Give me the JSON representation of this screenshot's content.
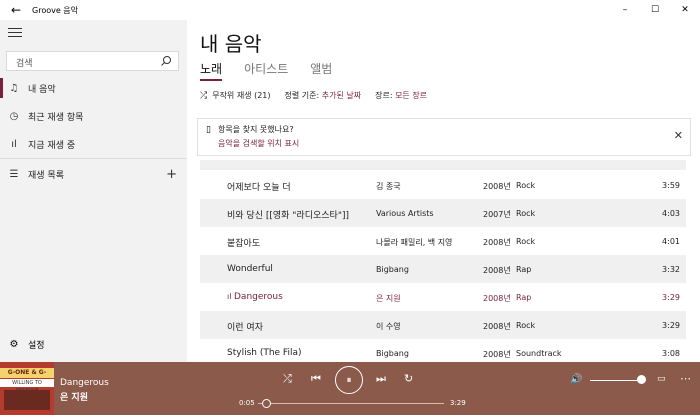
{
  "window": {
    "title": "Groove 음악",
    "back": "←",
    "min": "–",
    "max": "☐",
    "close": "✕"
  },
  "sidebar": {
    "search_placeholder": "검색",
    "items": [
      {
        "label": "내 음악",
        "icon": "music-note-icon",
        "glyph": "♫"
      },
      {
        "label": "최근 재생 항목",
        "icon": "clock-icon",
        "glyph": "◷"
      },
      {
        "label": "지금 재생 중",
        "icon": "equalizer-icon",
        "glyph": "ıl"
      },
      {
        "label": "재생 목록",
        "icon": "playlist-icon",
        "glyph": "☰"
      }
    ],
    "add": "+",
    "settings": {
      "label": "설정",
      "glyph": "⚙"
    }
  },
  "main": {
    "title": "내 음악",
    "tabs": [
      "노래",
      "아티스트",
      "앨범"
    ],
    "toolbar": {
      "shuffle_label": "무작위 재생 (21)",
      "sort_label": "정렬 기준:",
      "sort_value": "추가된 날짜",
      "genre_label": "장르:",
      "genre_value": "모든 장르"
    },
    "notice": {
      "question": "항목을 찾지 못했나요?",
      "link": "음악을 검색할 위치 표시",
      "close": "✕"
    },
    "songs": [
      {
        "title": "어제보다 오늘 더",
        "artist": "김 종국",
        "year": "2008년",
        "genre": "Rock",
        "duration": "3:59"
      },
      {
        "title": "비와 당신 [[영화 \"라디오스타\"]]",
        "artist": "Various Artists",
        "year": "2007년",
        "genre": "Rock",
        "duration": "4:03"
      },
      {
        "title": "붙잡아도",
        "artist": "나몰라 패밀리, 백 지영",
        "year": "2008년",
        "genre": "Rock",
        "duration": "4:01"
      },
      {
        "title": "Wonderful",
        "artist": "Bigbang",
        "year": "2008년",
        "genre": "Rap",
        "duration": "3:32"
      },
      {
        "title": "Dangerous",
        "artist": "은 지원",
        "year": "2008년",
        "genre": "Rap",
        "duration": "3:29"
      },
      {
        "title": "이런 여자",
        "artist": "이 수영",
        "year": "2008년",
        "genre": "Rock",
        "duration": "3:29"
      },
      {
        "title": "Stylish (The Fila)",
        "artist": "Bigbang",
        "year": "2008년",
        "genre": "Soundtrack",
        "duration": "3:08"
      }
    ]
  },
  "player": {
    "album_art_text": [
      "G-ONE & G-CODE",
      "WILLING TO DESERVE"
    ],
    "title": "Dangerous",
    "artist": "은 지원",
    "elapsed": "0:05",
    "total": "3:29",
    "progress": 0.024,
    "volume": 1.0,
    "controls": {
      "shuffle": "⤮",
      "prev": "⏮",
      "pause": "⏸",
      "next": "⏭",
      "repeat": "↻",
      "volume": "🔊",
      "miniview": "▭",
      "more": "⋯"
    }
  },
  "colors": {
    "accent": "#7a1f3d",
    "player_bg": "#8c5a4b",
    "sidebar_bg": "#f2f2f2"
  }
}
